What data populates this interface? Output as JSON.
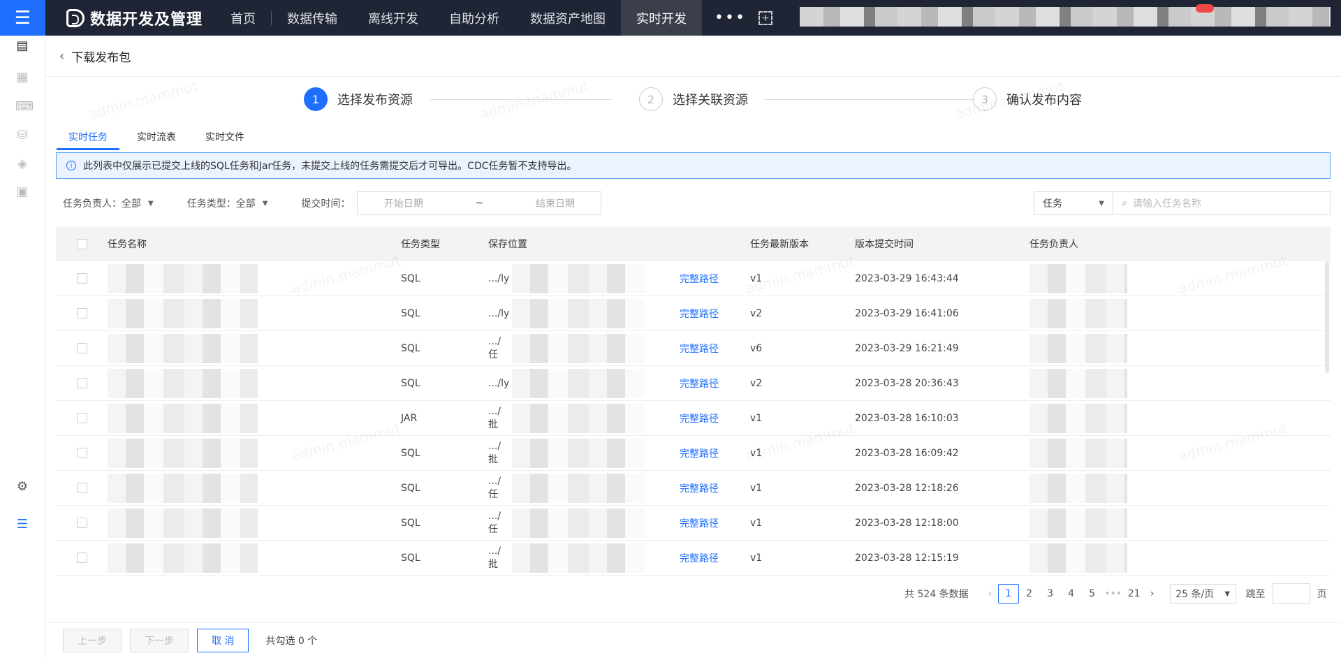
{
  "topbar": {
    "brand": "数据开发及管理",
    "nav": [
      "首页",
      "数据传输",
      "离线开发",
      "自助分析",
      "数据资产地图",
      "实时开发"
    ],
    "active_nav": "实时开发",
    "more": "•••"
  },
  "page": {
    "title": "下载发布包"
  },
  "steps": [
    {
      "num": "1",
      "label": "选择发布资源"
    },
    {
      "num": "2",
      "label": "选择关联资源"
    },
    {
      "num": "3",
      "label": "确认发布内容"
    }
  ],
  "tabs": [
    "实时任务",
    "实时流表",
    "实时文件"
  ],
  "info": "此列表中仅展示已提交上线的SQL任务和Jar任务，未提交上线的任务需提交后才可导出。CDC任务暂不支持导出。",
  "filters": {
    "owner": "任务负责人：全部",
    "type": "任务类型：全部",
    "submit_time_label": "提交时间：",
    "start_placeholder": "开始日期",
    "end_placeholder": "结束日期",
    "range_sep": "~"
  },
  "search": {
    "type": "任务",
    "placeholder": "请输入任务名称"
  },
  "table": {
    "headers": [
      "任务名称",
      "任务类型",
      "保存位置",
      "任务最新版本",
      "版本提交时间",
      "任务负责人"
    ],
    "link_text": "完整路径",
    "rows": [
      {
        "type": "SQL",
        "path": ".../ly",
        "version": "v1",
        "time": "2023-03-29 16:43:44"
      },
      {
        "type": "SQL",
        "path": ".../ly",
        "version": "v2",
        "time": "2023-03-29 16:41:06"
      },
      {
        "type": "SQL",
        "path": ".../任",
        "version": "v6",
        "time": "2023-03-29 16:21:49"
      },
      {
        "type": "SQL",
        "path": ".../ly",
        "version": "v2",
        "time": "2023-03-28 20:36:43"
      },
      {
        "type": "JAR",
        "path": ".../批",
        "version": "v1",
        "time": "2023-03-28 16:10:03"
      },
      {
        "type": "SQL",
        "path": ".../批",
        "version": "v1",
        "time": "2023-03-28 16:09:42"
      },
      {
        "type": "SQL",
        "path": ".../任",
        "version": "v1",
        "time": "2023-03-28 12:18:26"
      },
      {
        "type": "SQL",
        "path": ".../任",
        "version": "v1",
        "time": "2023-03-28 12:18:00"
      },
      {
        "type": "SQL",
        "path": ".../批",
        "version": "v1",
        "time": "2023-03-28 12:15:19"
      }
    ]
  },
  "pagination": {
    "total": "共 524 条数据",
    "pages": [
      "1",
      "2",
      "3",
      "4",
      "5"
    ],
    "ellipsis": "•••",
    "last": "21",
    "page_size": "25 条/页",
    "jump_label": "跳至",
    "page_unit": "页"
  },
  "footer": {
    "prev": "上一步",
    "next": "下一步",
    "cancel": "取 消",
    "selected": "共勾选 0 个"
  }
}
